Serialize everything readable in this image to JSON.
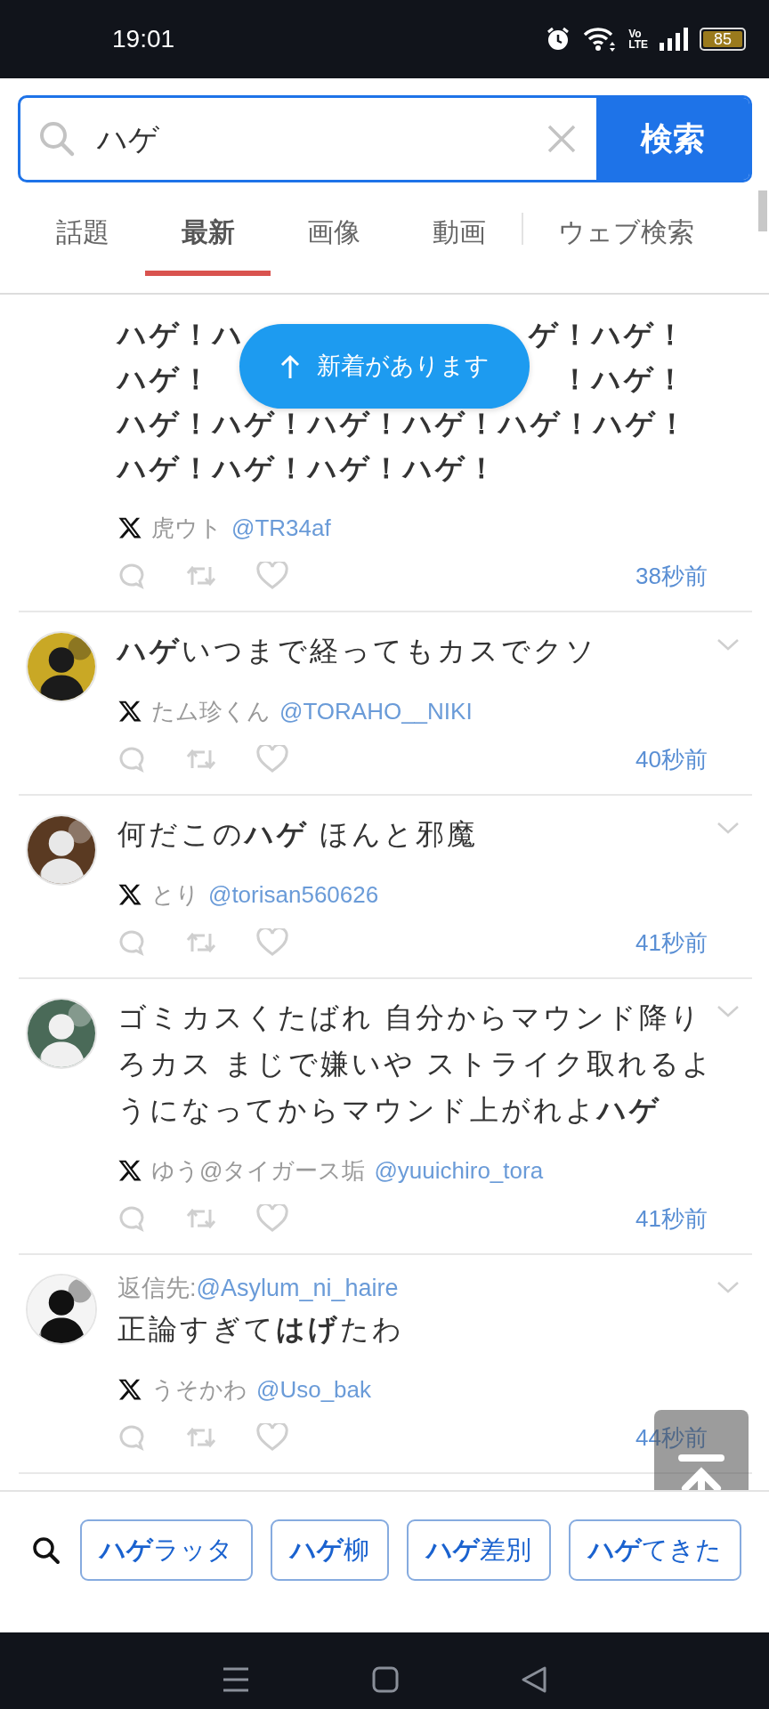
{
  "status_bar": {
    "time": "19:01",
    "network_label": [
      "Vo",
      "LTE"
    ],
    "battery": "85"
  },
  "search": {
    "value": "ハゲ",
    "button": "検索"
  },
  "tabs": [
    {
      "label": "話題",
      "selected": false,
      "separated": false
    },
    {
      "label": "最新",
      "selected": true,
      "separated": false
    },
    {
      "label": "画像",
      "selected": false,
      "separated": false
    },
    {
      "label": "動画",
      "selected": false,
      "separated": false
    },
    {
      "label": "ウェブ検索",
      "selected": false,
      "separated": true
    }
  ],
  "new_posts_button": {
    "label": "新着があります"
  },
  "posts": [
    {
      "bold": true,
      "menu": false,
      "body_lines": [
        {
          "left": "ハゲ！ハ",
          "right": "ゲ！ハゲ！"
        },
        {
          "left": "ハゲ！",
          "right": "！ハゲ！"
        },
        {
          "text": "ハゲ！ハゲ！ハゲ！ハゲ！ハゲ！ハゲ！"
        },
        {
          "text": "ハゲ！ハゲ！ハゲ！ハゲ！"
        }
      ],
      "author": "虎ウト",
      "handle": "@TR34af",
      "time": "38秒前"
    },
    {
      "bold": false,
      "menu": true,
      "avatar": {
        "kind": "picture"
      },
      "body_lines": [
        {
          "text": "**ハゲ**いつまで経ってもカスでクソ"
        }
      ],
      "author": "たム珍くん",
      "handle": "@TORAHO__NIKI",
      "time": "40秒前"
    },
    {
      "bold": false,
      "menu": true,
      "avatar": {
        "kind": "picture"
      },
      "body_lines": [
        {
          "text": "何だこの**ハゲ** ほんと邪魔"
        }
      ],
      "author": "とり",
      "handle": "@torisan560626",
      "time": "41秒前"
    },
    {
      "bold": false,
      "menu": true,
      "avatar": {
        "kind": "picture"
      },
      "body_lines": [
        {
          "text": "ゴミカスくたばれ 自分からマウンド降り"
        },
        {
          "text": "ろカス まじで嫌いや ストライク取れるよ"
        },
        {
          "text": "うになってからマウンド上がれよ**ハゲ**"
        }
      ],
      "author": "ゆう@タイガース垢",
      "handle": "@yuuichiro_tora",
      "time": "41秒前"
    },
    {
      "bold": false,
      "menu": true,
      "avatar": {
        "kind": "picture"
      },
      "reply_prefix": "返信先:",
      "reply_handle": "@Asylum_ni_haire",
      "body_lines": [
        {
          "text": "正論すぎて**はげ**たわ"
        }
      ],
      "author": "うそかわ",
      "handle": "@Uso_bak",
      "time": "44秒前"
    }
  ],
  "suggestions": [
    "**ハゲ**ラッタ",
    "**ハゲ**柳",
    "**ハゲ**差別",
    "**ハゲ**てきた"
  ]
}
